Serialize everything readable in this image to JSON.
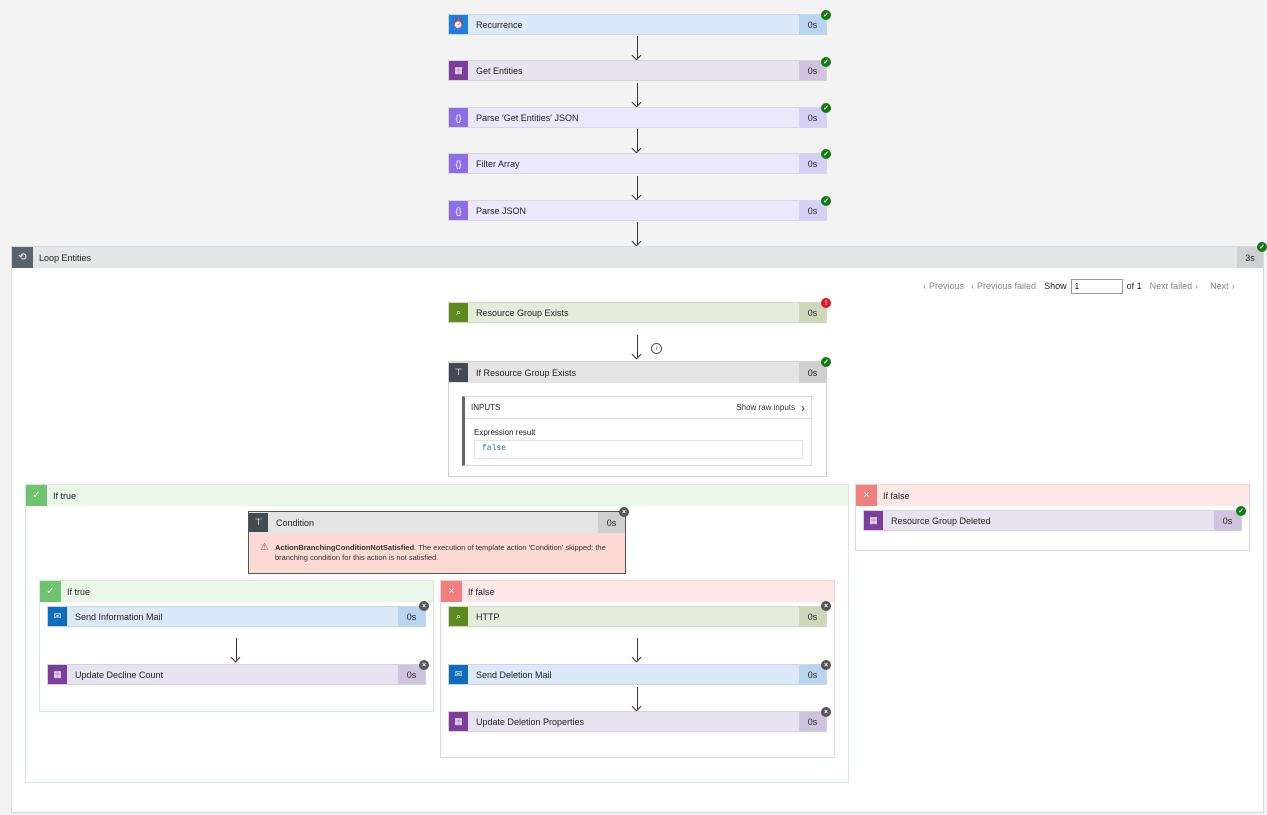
{
  "flow": {
    "recurrence": {
      "title": "Recurrence",
      "duration": "0s"
    },
    "get_entities": {
      "title": "Get Entities",
      "duration": "0s"
    },
    "parse_get_entities": {
      "title": "Parse 'Get Entities' JSON",
      "duration": "0s"
    },
    "filter_array": {
      "title": "Filter Array",
      "duration": "0s"
    },
    "parse_json": {
      "title": "Parse JSON",
      "duration": "0s"
    }
  },
  "loop": {
    "title": "Loop Entities",
    "duration": "3s",
    "pager": {
      "previous": "Previous",
      "previous_failed": "Previous failed",
      "show": "Show",
      "value": "1",
      "of": "of 1",
      "next_failed": "Next failed",
      "next": "Next"
    },
    "resource_group_exists": {
      "title": "Resource Group Exists",
      "duration": "0s"
    },
    "if_rg_exists": {
      "title": "If Resource Group Exists",
      "duration": "0s",
      "inputs_label": "INPUTS",
      "show_raw": "Show raw inputs",
      "expr_label": "Expression result",
      "expr_value": "false"
    },
    "if_true": {
      "label": "If true",
      "condition": {
        "title": "Condition",
        "duration": "0s",
        "error_code": "ActionBranchingConditionNotSatisfied",
        "error_text": ". The execution of template action 'Condition' skipped: the branching condition for this action is not satisfied."
      },
      "inner_true": {
        "label": "If true",
        "send_info_mail": {
          "title": "Send Information Mail",
          "duration": "0s"
        },
        "update_decline": {
          "title": "Update Decline Count",
          "duration": "0s"
        }
      },
      "inner_false": {
        "label": "If false",
        "http": {
          "title": "HTTP",
          "duration": "0s"
        },
        "send_deletion_mail": {
          "title": "Send Deletion Mail",
          "duration": "0s"
        },
        "update_deletion": {
          "title": "Update Deletion Properties",
          "duration": "0s"
        }
      }
    },
    "if_false": {
      "label": "If false",
      "rg_deleted": {
        "title": "Resource Group Deleted",
        "duration": "0s"
      }
    }
  },
  "colors": {
    "success": "#107c10",
    "error": "#e81123",
    "skipped": "#555555",
    "true_branch": "#6fc36f",
    "false_branch": "#f08080"
  }
}
